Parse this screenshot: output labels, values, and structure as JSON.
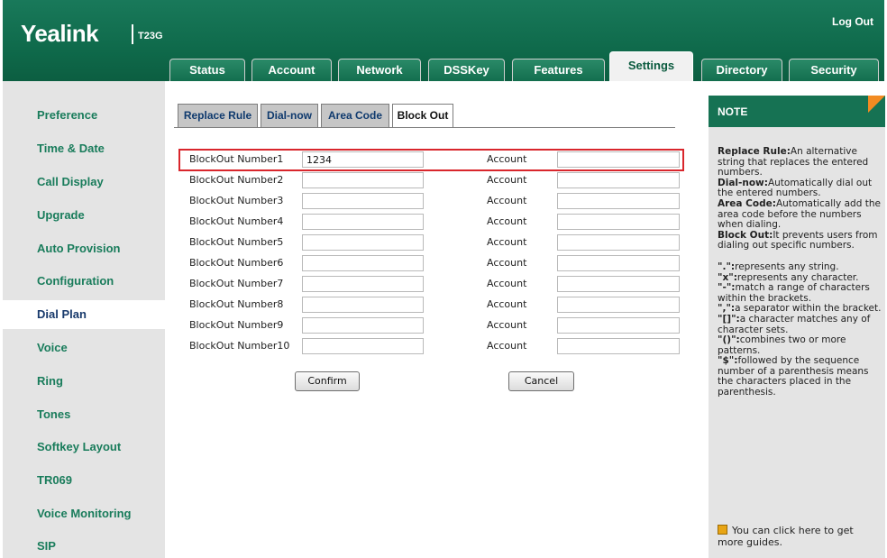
{
  "header": {
    "logo": "Yealink",
    "model": "T23G",
    "logout": "Log Out",
    "tabs": [
      "Status",
      "Account",
      "Network",
      "DSSKey",
      "Features",
      "Settings",
      "Directory",
      "Security"
    ],
    "active_tab": "Settings"
  },
  "sidebar": {
    "items": [
      "Preference",
      "Time & Date",
      "Call Display",
      "Upgrade",
      "Auto Provision",
      "Configuration",
      "Dial Plan",
      "Voice",
      "Ring",
      "Tones",
      "Softkey Layout",
      "TR069",
      "Voice Monitoring",
      "SIP"
    ],
    "active": "Dial Plan"
  },
  "subtabs": {
    "items": [
      "Replace Rule",
      "Dial-now",
      "Area Code",
      "Block Out"
    ],
    "active": "Block Out"
  },
  "blockout": {
    "rows": [
      {
        "label": "BlockOut Number1",
        "number": "1234",
        "account_label": "Account",
        "account": ""
      },
      {
        "label": "BlockOut Number2",
        "number": "",
        "account_label": "Account",
        "account": ""
      },
      {
        "label": "BlockOut Number3",
        "number": "",
        "account_label": "Account",
        "account": ""
      },
      {
        "label": "BlockOut Number4",
        "number": "",
        "account_label": "Account",
        "account": ""
      },
      {
        "label": "BlockOut Number5",
        "number": "",
        "account_label": "Account",
        "account": ""
      },
      {
        "label": "BlockOut Number6",
        "number": "",
        "account_label": "Account",
        "account": ""
      },
      {
        "label": "BlockOut Number7",
        "number": "",
        "account_label": "Account",
        "account": ""
      },
      {
        "label": "BlockOut Number8",
        "number": "",
        "account_label": "Account",
        "account": ""
      },
      {
        "label": "BlockOut Number9",
        "number": "",
        "account_label": "Account",
        "account": ""
      },
      {
        "label": "BlockOut Number10",
        "number": "",
        "account_label": "Account",
        "account": ""
      }
    ],
    "confirm": "Confirm",
    "cancel": "Cancel"
  },
  "note": {
    "title": "NOTE",
    "definitions": [
      {
        "term": "Replace Rule:",
        "text": "An alternative string that replaces the entered numbers."
      },
      {
        "term": "Dial-now:",
        "text": "Automatically dial out the entered numbers."
      },
      {
        "term": "Area Code:",
        "text": "Automatically add the area code before the numbers when dialing."
      },
      {
        "term": "Block Out:",
        "text": "It prevents users from dialing out specific numbers."
      }
    ],
    "patterns": [
      {
        "term": "\".\":",
        "text": "represents any string."
      },
      {
        "term": "\"x\":",
        "text": "represents any character."
      },
      {
        "term": "\"-\":",
        "text": "match a range of characters within the brackets."
      },
      {
        "term": "\",\":",
        "text": "a separator within the bracket."
      },
      {
        "term": "\"[]\":",
        "text": "a character matches any of character sets."
      },
      {
        "term": "\"()\":",
        "text": "combines two or more patterns."
      },
      {
        "term": "\"$\":",
        "text": "followed by the sequence number of a parenthesis means the characters placed in the parenthesis."
      }
    ],
    "guide": "You can click here to get more guides.",
    "accent_color": "#f28b22"
  },
  "colors": {
    "header_green": "#0f6a4b",
    "sidebar_text": "#197c5b",
    "highlight_red": "#d9262c"
  }
}
